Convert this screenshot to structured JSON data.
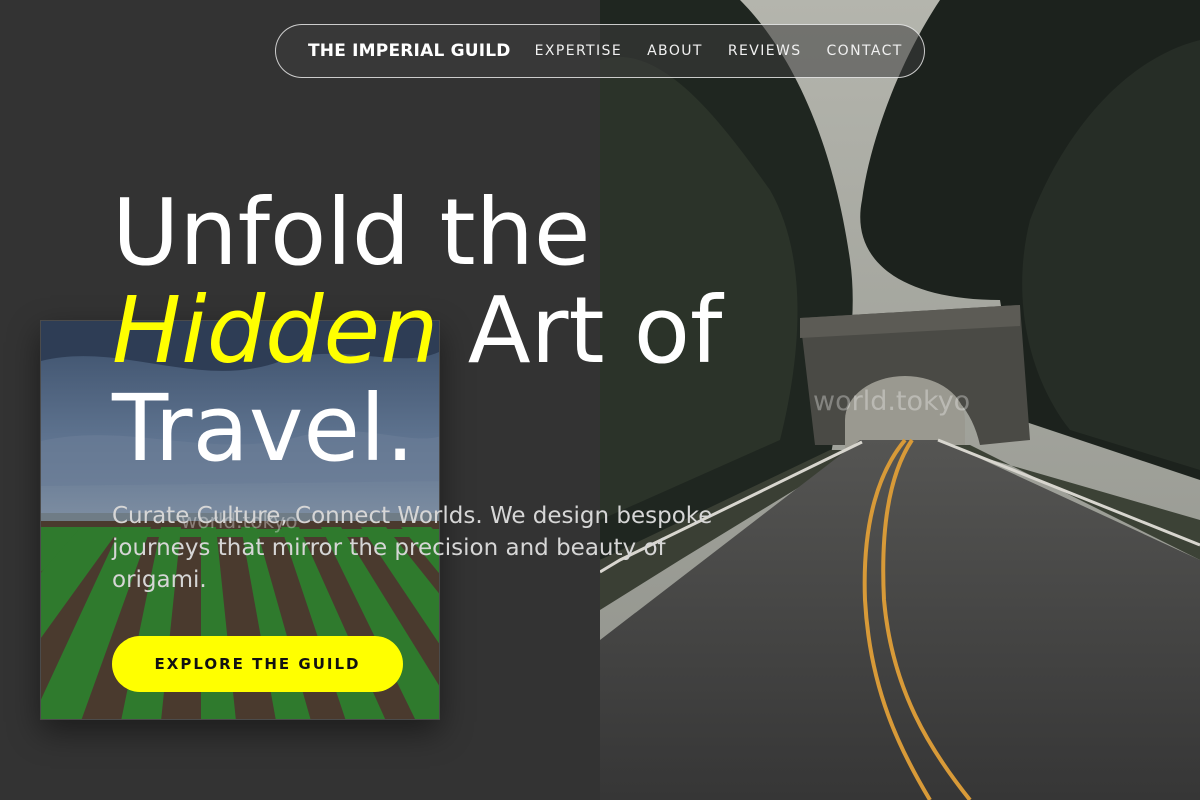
{
  "nav": {
    "brand": "THE IMPERIAL GUILD",
    "links": [
      "EXPERTISE",
      "ABOUT",
      "REVIEWS",
      "CONTACT"
    ]
  },
  "hero": {
    "headline_line1": "Unfold the",
    "headline_accent": "Hidden",
    "headline_line2_rest": " Art of",
    "headline_line3": "Travel.",
    "subtitle": "Curate Culture, Connect Worlds. We design bespoke journeys that mirror the precision and beauty of origami.",
    "cta_label": "EXPLORE THE GUILD"
  },
  "images": {
    "main_watermark": "world.tokyo",
    "inset_watermark": "world.tokyo"
  },
  "colors": {
    "background": "#333333",
    "accent": "#ffff00",
    "text": "#ffffff",
    "subtitle": "#d6d6d6"
  }
}
